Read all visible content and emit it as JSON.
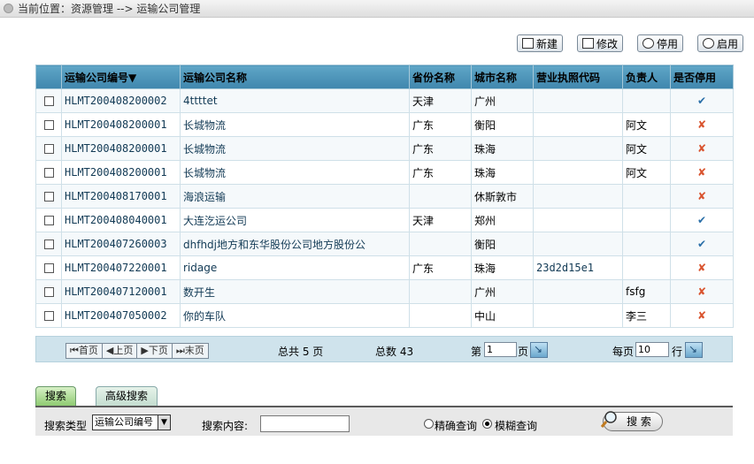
{
  "breadcrumb": "当前位置：资源管理 --> 运输公司管理",
  "toolbar": {
    "new": "新建",
    "edit": "修改",
    "disable": "停用",
    "enable": "启用"
  },
  "table": {
    "headers": [
      "运输公司编号▼",
      "运输公司名称",
      "省份名称",
      "城市名称",
      "营业执照代码",
      "负责人",
      "是否停用"
    ],
    "rows": [
      {
        "code": "HLMT200408200002",
        "name": "4ttttet",
        "province": "天津",
        "city": "广州",
        "license": "",
        "owner": "",
        "status": "✔"
      },
      {
        "code": "HLMT200408200001",
        "name": "长城物流",
        "province": "广东",
        "city": "衡阳",
        "license": "",
        "owner": "阿文",
        "status": "✘"
      },
      {
        "code": "HLMT200408200001",
        "name": "长城物流",
        "province": "广东",
        "city": "珠海",
        "license": "",
        "owner": "阿文",
        "status": "✘"
      },
      {
        "code": "HLMT200408200001",
        "name": "长城物流",
        "province": "广东",
        "city": "珠海",
        "license": "",
        "owner": "阿文",
        "status": "✘"
      },
      {
        "code": "HLMT200408170001",
        "name": "海浪运输",
        "province": "",
        "city": "休斯敦市",
        "license": "",
        "owner": "",
        "status": "✘"
      },
      {
        "code": "HLMT200408040001",
        "name": "大连汔运公司",
        "province": "天津",
        "city": "郑州",
        "license": "",
        "owner": "",
        "status": "✔"
      },
      {
        "code": "HLMT200407260003",
        "name": "dhfhdj地方和东华股份公司地方股份公",
        "province": "",
        "city": "衡阳",
        "license": "",
        "owner": "",
        "status": "✔"
      },
      {
        "code": "HLMT200407220001",
        "name": "ridage",
        "province": "广东",
        "city": "珠海",
        "license": "23d2d15e1",
        "owner": "",
        "status": "✘"
      },
      {
        "code": "HLMT200407120001",
        "name": "数开生",
        "province": "",
        "city": "广州",
        "license": "",
        "owner": "fsfg",
        "status": "✘"
      },
      {
        "code": "HLMT200407050002",
        "name": "你的车队",
        "province": "",
        "city": "中山",
        "license": "",
        "owner": "李三",
        "status": "✘"
      }
    ]
  },
  "pager": {
    "first": "首页",
    "prev": "上页",
    "next": "下页",
    "last": "末页",
    "total_pages": "总共 5 页",
    "total_count": "总数 43",
    "page_prefix": "第",
    "page_value": "1",
    "page_suffix": "页",
    "per_page_prefix": "每页",
    "per_page_value": "10",
    "per_page_suffix": "行"
  },
  "tabs": {
    "search": "搜索",
    "advanced": "高级搜索"
  },
  "search": {
    "type_label": "搜索类型",
    "type_value": "运输公司编号",
    "content_label": "搜索内容:",
    "exact_label": "精确查询",
    "fuzzy_label": "模糊查询",
    "button_label": "搜 索"
  },
  "colors": {
    "header_bg": "#4b93b9",
    "yes": "#2a6fa8",
    "no": "#d9542f"
  }
}
